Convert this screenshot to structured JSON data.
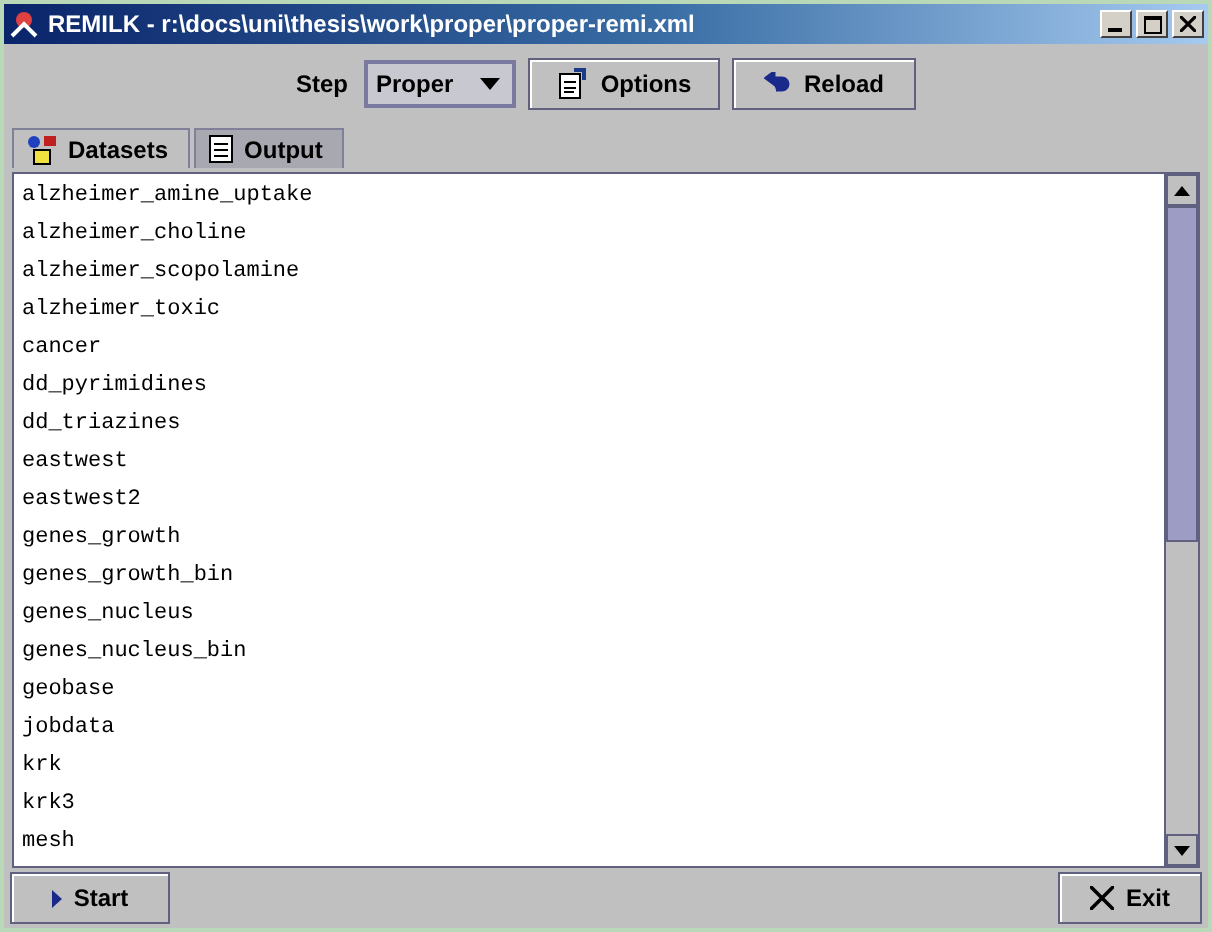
{
  "window": {
    "title": "REMILK - r:\\docs\\uni\\thesis\\work\\proper\\proper-remi.xml"
  },
  "toolbar": {
    "step_label": "Step",
    "step_value": "Proper",
    "buttons": [
      {
        "label": "Options",
        "kind": "options"
      },
      {
        "label": "Reload",
        "kind": "reload"
      }
    ]
  },
  "tabs": [
    {
      "label": "Datasets",
      "kind": "datasets",
      "selected": true
    },
    {
      "label": "Output",
      "kind": "output",
      "selected": false
    }
  ],
  "datasets": [
    "alzheimer_amine_uptake",
    "alzheimer_choline",
    "alzheimer_scopolamine",
    "alzheimer_toxic",
    "cancer",
    "dd_pyrimidines",
    "dd_triazines",
    "eastwest",
    "eastwest2",
    "genes_growth",
    "genes_growth_bin",
    "genes_nucleus",
    "genes_nucleus_bin",
    "geobase",
    "jobdata",
    "krk",
    "krk3",
    "mesh"
  ],
  "footer": {
    "start": "Start",
    "exit": "Exit"
  }
}
